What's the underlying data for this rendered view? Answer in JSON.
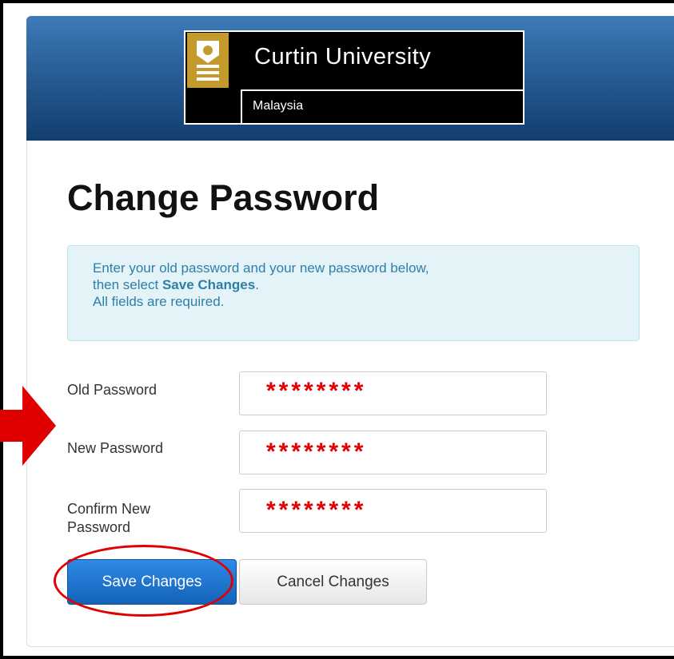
{
  "header": {
    "university_name": "Curtin University",
    "campus": "Malaysia"
  },
  "page": {
    "title": "Change Password"
  },
  "info": {
    "line1": "Enter your old password and your new password below,",
    "line2_prefix": "then select ",
    "line2_bold": "Save Changes",
    "line2_suffix": ".",
    "line3": "All fields are required."
  },
  "form": {
    "old_password": {
      "label": "Old Password",
      "value": "********"
    },
    "new_password": {
      "label": "New Password",
      "value": "********"
    },
    "confirm_password": {
      "label_line1": "Confirm New",
      "label_line2": "Password",
      "value": "********"
    }
  },
  "buttons": {
    "save": "Save Changes",
    "cancel": "Cancel Changes"
  },
  "colors": {
    "header_blue": "#24578e",
    "logo_gold": "#c59a2c",
    "info_bg": "#e4f3f8",
    "info_text": "#2e7fa8",
    "primary_button": "#1462b8",
    "annotation_red": "#e00000"
  }
}
